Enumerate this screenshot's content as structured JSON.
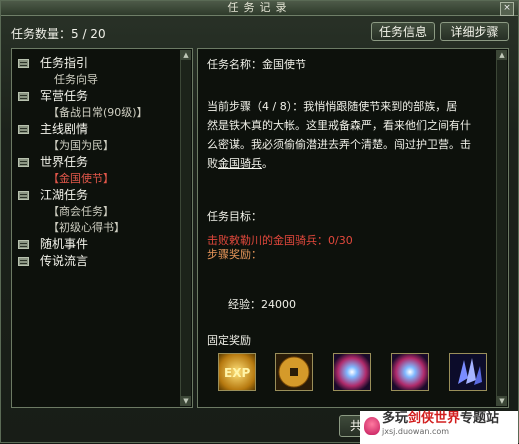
{
  "window": {
    "title": "任务记录",
    "close_symbol": "×"
  },
  "header": {
    "count_label": "任务数量：5 / 20",
    "buttons": {
      "info": "任务信息",
      "detail": "详细步骤"
    }
  },
  "tree": {
    "categories": [
      {
        "label": "任务指引",
        "items": [
          {
            "label": "任务向导",
            "style": "plain"
          }
        ]
      },
      {
        "label": "军营任务",
        "items": [
          {
            "label": "【备战日常(90级)】"
          }
        ]
      },
      {
        "label": "主线剧情",
        "items": [
          {
            "label": "【为国为民】"
          }
        ]
      },
      {
        "label": "世界任务",
        "items": [
          {
            "label": "【金国使节】",
            "selected": true
          }
        ]
      },
      {
        "label": "江湖任务",
        "items": [
          {
            "label": "【商会任务】"
          },
          {
            "label": "【初级心得书】"
          }
        ]
      },
      {
        "label": "随机事件",
        "items": []
      },
      {
        "label": "传说流言",
        "items": []
      }
    ]
  },
  "detail": {
    "name_line": "任务名称：金国使节",
    "step_line1": "当前步骤（4 / 8）：我悄悄跟随使节来到的部族，居",
    "step_line2": "然是铁木真的大帐。这里戒备森严，看来他们之间有什",
    "step_line3": "么密谋。我必须偷偷潜进去弄个清楚。闯过护卫营。击",
    "step_line4_prefix": "败",
    "step_line4_link": "金国骑兵",
    "step_line4_suffix": "。",
    "goal_label": "任务目标：",
    "goal_text": "击败敕勒川的金国骑兵：0/30",
    "reward_label": "步骤奖励：",
    "exp_text": "经验：24000",
    "fixed_reward_label": "固定奖励",
    "reward_icons": [
      "exp-scroll-icon",
      "coin-icon",
      "starburst-icon",
      "starburst-icon",
      "crystal-icon"
    ]
  },
  "footer": {
    "share_label": "共 享"
  },
  "watermark": {
    "prefix": "多玩",
    "red": "剑侠世界",
    "suffix": "专题站",
    "url": "jxsj.duowan.com"
  },
  "colors": {
    "selected": "#e2574a",
    "goal_red": "#e2483c",
    "reward_orange": "#e6965a"
  }
}
